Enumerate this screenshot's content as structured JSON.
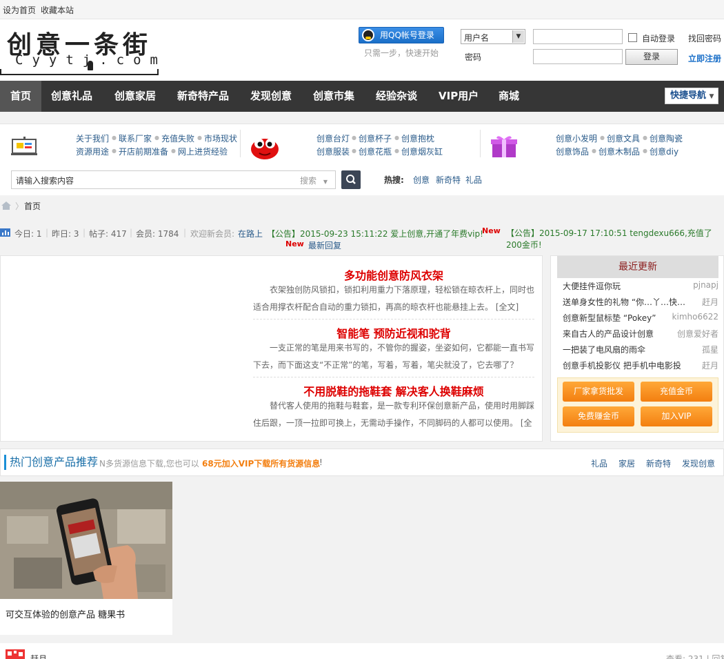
{
  "topbar": {
    "set_home": "设为首页",
    "bookmark": "收藏本站"
  },
  "logo": {
    "chars": "创意一条街",
    "sub": "Cyytj.com"
  },
  "login": {
    "qq_button": "用QQ帐号登录",
    "qq_hint": "只需一步，快速开始",
    "user_select": "用户名",
    "password_label": "密码",
    "auto_login": "自动登录",
    "find_password": "找回密码",
    "login_button": "登录",
    "register": "立即注册"
  },
  "nav": {
    "items": [
      "首页",
      "创意礼品",
      "创意家居",
      "新奇特产品",
      "发现创意",
      "创意市集",
      "经验杂谈",
      "VIP用户",
      "商城"
    ],
    "quick": "快捷导航"
  },
  "categories": {
    "group1": [
      "关于我们",
      "联系厂家",
      "充值失败",
      "市场现状",
      "资源用途",
      "开店前期准备",
      "网上进货经验"
    ],
    "group2": [
      "创意台灯",
      "创意杯子",
      "创意抱枕",
      "创意服装",
      "创意花瓶",
      "创意烟灰缸"
    ],
    "group3": [
      "创意小发明",
      "创意文具",
      "创意陶瓷",
      "创意饰品",
      "创意木制品",
      "创意diy"
    ]
  },
  "search": {
    "placeholder": "请输入搜索内容",
    "type": "搜索",
    "hot_label": "热搜:",
    "hot_words": [
      "创意",
      "新奇特",
      "礼品"
    ]
  },
  "breadcrumb": {
    "home": "首页"
  },
  "stats": {
    "today": "今日: 1",
    "yesterday": "昨日: 3",
    "posts": "帖子: 417",
    "members": "会员: 1784",
    "welcome": "欢迎新会员:",
    "new_member": "在路上",
    "notice1": "【公告】2015-09-23 15:11:22 爱上创意,开通了年费vip!",
    "notice2": "【公告】2015-09-17 17:10:51 tengdexu666,充值了200金币!",
    "new_tag": "New",
    "latest_reply": "最新回复"
  },
  "articles": [
    {
      "title": "多功能创意防风衣架",
      "text": "衣架独创防风锁扣，锁扣利用重力下落原理，轻松锁在晾衣杆上，同时也适合用撑衣杆配合自动的重力锁扣，再高的晾衣杆也能悬挂上去。 [全文]"
    },
    {
      "title": "智能笔  预防近视和驼背",
      "text": "一支正常的笔是用来书写的，不管你的握姿，坐姿如何，它都能一直书写下去，而下面这支“不正常”的笔，写着，写着，笔尖就没了，它去哪了？"
    },
    {
      "title": "不用脱鞋的拖鞋套  解决客人换鞋麻烦",
      "text": "替代客人使用的拖鞋与鞋套，是一款专利环保创意新产品，使用时用脚踩住后跟，一顶一拉即可换上，无需动手操作，不同脚码的人都可以使用。 [全"
    }
  ],
  "sidebar": {
    "title": "最近更新",
    "items": [
      {
        "title": "大便挂件逗你玩",
        "user": "pjnapj"
      },
      {
        "title": "送单身女性的礼物 “你…丫…快…",
        "user": "赶月"
      },
      {
        "title": "创意新型鼠标垫 “Pokey”",
        "user": "kimho6622"
      },
      {
        "title": "来自古人的产品设计创意",
        "user": "创意爱好者"
      },
      {
        "title": "一把装了电风扇的雨伞",
        "user": "孤星"
      },
      {
        "title": "创意手机投影仪  把手机中电影投",
        "user": "赶月"
      }
    ],
    "buttons": [
      "厂家拿货批发",
      "充值金币",
      "免费赚金币",
      "加入VIP"
    ]
  },
  "hot_section": {
    "title": "热门创意产品推荐",
    "desc": "N多货源信息下载,您也可以",
    "vip": "68元加入VIP下载所有货源信息",
    "excl": "!",
    "tabs": [
      "礼品",
      "家居",
      "新奇特",
      "发现创意"
    ]
  },
  "product": {
    "caption": "可交互体验的创意产品  糖果书"
  },
  "bottom": {
    "user": "赶月",
    "views": "查看: 231 | 回复"
  },
  "colors": {
    "nav_bg": "#363636",
    "accent_red": "#dd0000",
    "orange": "#f37f10",
    "link_blue": "#2a5b8a"
  }
}
